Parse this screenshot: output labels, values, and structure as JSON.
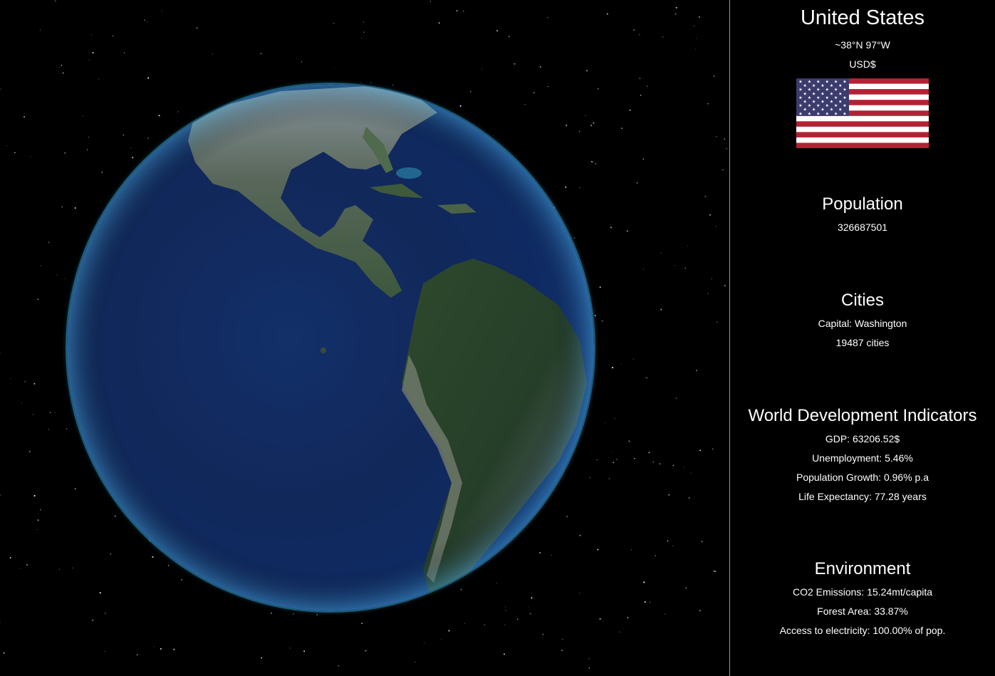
{
  "country": {
    "name": "United States",
    "coords": "~38°N 97°W",
    "currency": "USD$",
    "flag_icon": "us-flag-icon"
  },
  "population": {
    "heading": "Population",
    "value": "326687501"
  },
  "cities": {
    "heading": "Cities",
    "capital": "Capital: Washington",
    "count": "19487 cities"
  },
  "wdi": {
    "heading": "World Development Indicators",
    "gdp": "GDP: 63206.52$",
    "unemployment": "Unemployment: 5.46%",
    "population_growth": "Population Growth: 0.96% p.a",
    "life_expectancy": "Life Expectancy: 77.28 years"
  },
  "environment": {
    "heading": "Environment",
    "co2": "CO2 Emissions: 15.24mt/capita",
    "forest": "Forest Area: 33.87%",
    "electricity": "Access to electricity: 100.00% of pop."
  },
  "colors": {
    "background": "#000000",
    "ocean": "#13306a",
    "land": "#2c4429",
    "flag_red": "#b22234",
    "flag_blue": "#3c3b6e"
  }
}
